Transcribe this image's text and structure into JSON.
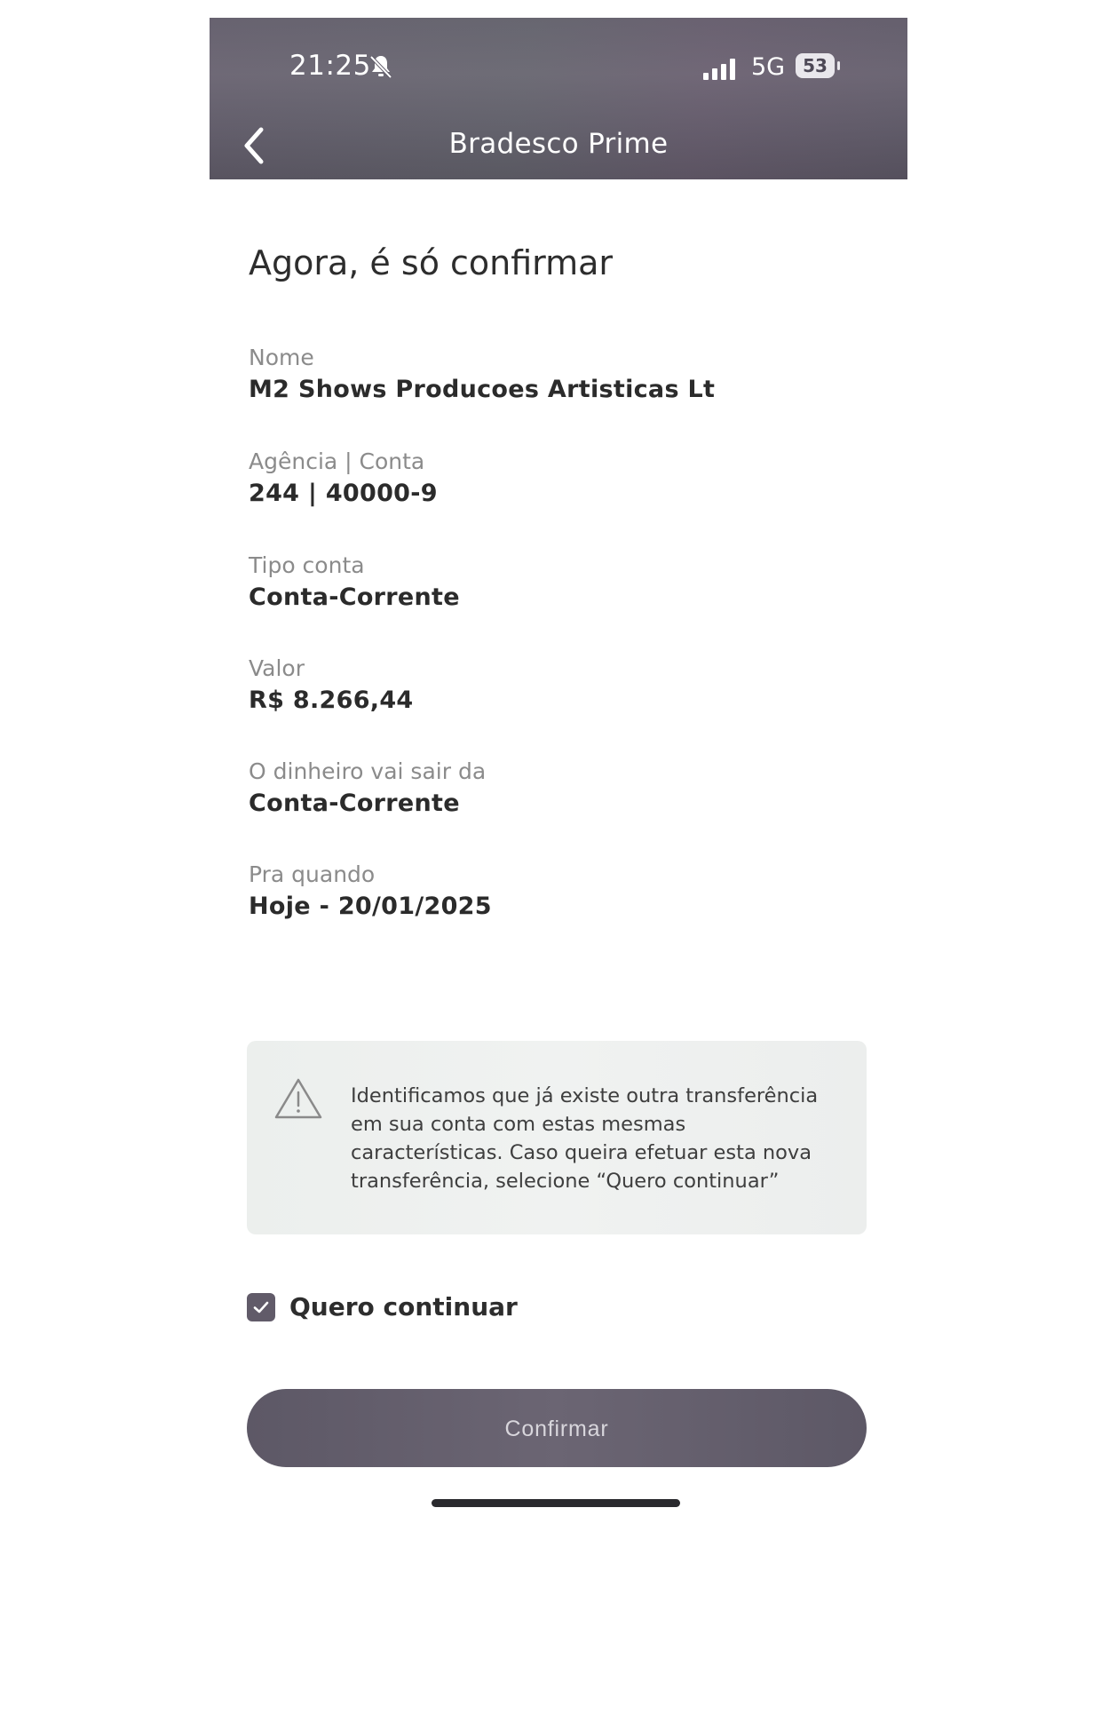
{
  "status_bar": {
    "time": "21:25",
    "network": "5G",
    "battery": "53"
  },
  "header": {
    "title": "Bradesco Prime"
  },
  "page": {
    "heading": "Agora, é só confirmar"
  },
  "fields": [
    {
      "label": "Nome",
      "value": "M2 Shows Producoes Artisticas Lt"
    },
    {
      "label": "Agência | Conta",
      "value": "244 | 40000-9"
    },
    {
      "label": "Tipo conta",
      "value": "Conta-Corrente"
    },
    {
      "label": "Valor",
      "value": "R$ 8.266,44"
    },
    {
      "label": "O dinheiro vai sair da",
      "value": "Conta-Corrente"
    },
    {
      "label": "Pra quando",
      "value": "Hoje - 20/01/2025"
    }
  ],
  "alert": {
    "icon": "warning-triangle-icon",
    "line1": "Identificamos que já existe outra transferência",
    "line2": "em sua conta com estas mesmas",
    "line3": "características. Caso queira efetuar esta nova",
    "line4": "transferência, selecione “Quero continuar”"
  },
  "continue_checkbox": {
    "label": "Quero continuar",
    "checked": true
  },
  "actions": {
    "confirm_label": "Confirmar"
  },
  "colors": {
    "header_bg": "#5f5a68",
    "button_bg": "#625c6a",
    "checkbox_bg": "#615b69",
    "alert_bg": "#eef0ef"
  }
}
